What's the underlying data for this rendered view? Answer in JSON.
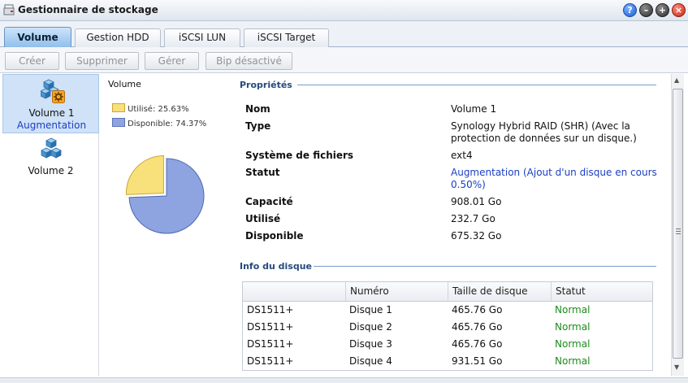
{
  "window": {
    "title": "Gestionnaire de stockage"
  },
  "window_buttons": {
    "help": "?",
    "min": "–",
    "max": "+",
    "close": "×"
  },
  "tabs": [
    {
      "label": "Volume",
      "active": true
    },
    {
      "label": "Gestion HDD",
      "active": false
    },
    {
      "label": "iSCSI LUN",
      "active": false
    },
    {
      "label": "iSCSI Target",
      "active": false
    }
  ],
  "toolbar": {
    "create": "Créer",
    "delete": "Supprimer",
    "manage": "Gérer",
    "beep": "Bip désactivé"
  },
  "volumes": [
    {
      "name": "Volume 1",
      "status": "Augmentation",
      "selected": true
    },
    {
      "name": "Volume 2",
      "status": "",
      "selected": false
    }
  ],
  "usage": {
    "title": "Volume",
    "used_label": "Utilisé: 25.63%",
    "free_label": "Disponible: 74.37%",
    "used_pct": 25.63,
    "free_pct": 74.37,
    "used_color": "#f8e07a",
    "free_color": "#8ea4e0"
  },
  "properties": {
    "title": "Propriétés",
    "name_label": "Nom",
    "name_value": "Volume 1",
    "type_label": "Type",
    "type_value": "Synology Hybrid RAID (SHR) (Avec la protection de données sur un disque.)",
    "fs_label": "Système de fichiers",
    "fs_value": "ext4",
    "status_label": "Statut",
    "status_value": "Augmentation (Ajout d'un disque en cours 0.50%)",
    "capacity_label": "Capacité",
    "capacity_value": "908.01 Go",
    "used_label": "Utilisé",
    "used_value": "232.7 Go",
    "available_label": "Disponible",
    "available_value": "675.32 Go"
  },
  "disk_info": {
    "title": "Info du disque",
    "columns": [
      "",
      "Numéro",
      "Taille de disque",
      "Statut"
    ],
    "rows": [
      [
        "DS1511+",
        "Disque 1",
        "465.76 Go",
        "Normal"
      ],
      [
        "DS1511+",
        "Disque 2",
        "465.76 Go",
        "Normal"
      ],
      [
        "DS1511+",
        "Disque 3",
        "465.76 Go",
        "Normal"
      ],
      [
        "DS1511+",
        "Disque 4",
        "931.51 Go",
        "Normal"
      ]
    ]
  },
  "icons": {
    "app": "storage-manager-icon",
    "volume": "cubes-stack-icon",
    "expanding_badge": "gear-badge-icon"
  }
}
